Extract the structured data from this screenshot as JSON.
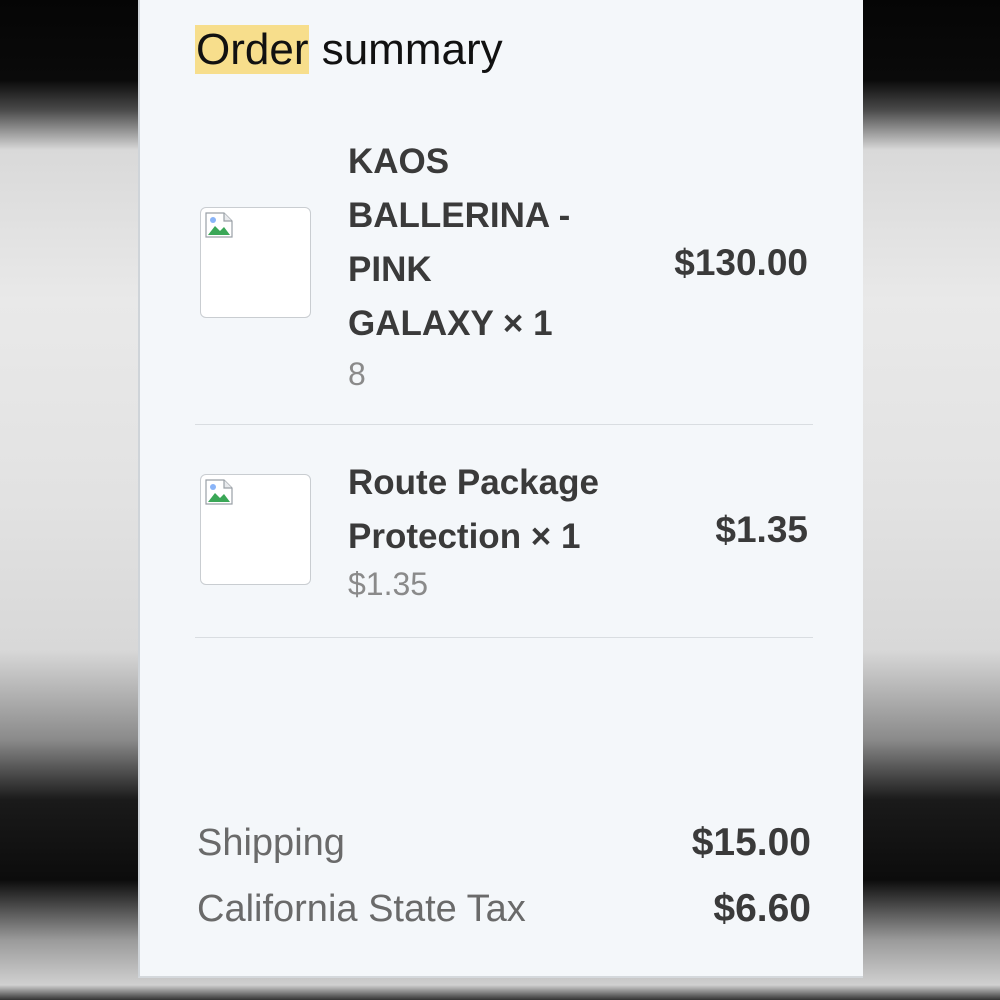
{
  "order_summary": {
    "title_highlight": "Order",
    "title_rest": " summary"
  },
  "line_items": [
    {
      "name_lines": [
        "KAOS",
        "BALLERINA -",
        "PINK",
        "GALAXY × 1"
      ],
      "variant": "8",
      "price": "$130.00",
      "image_icon": "broken-image-icon"
    },
    {
      "name_lines": [
        "Route Package",
        "Protection × 1"
      ],
      "variant": "$1.35",
      "price": "$1.35",
      "image_icon": "broken-image-icon"
    }
  ],
  "costs": {
    "shipping_label": "Shipping",
    "shipping_value": "$15.00",
    "tax_label": "California State Tax",
    "tax_value": "$6.60"
  },
  "colors": {
    "highlight": "#f7de8c",
    "card_background": "#f4f7fa",
    "primary_text": "#3a3a3a",
    "secondary_text": "#8a8a8a"
  }
}
